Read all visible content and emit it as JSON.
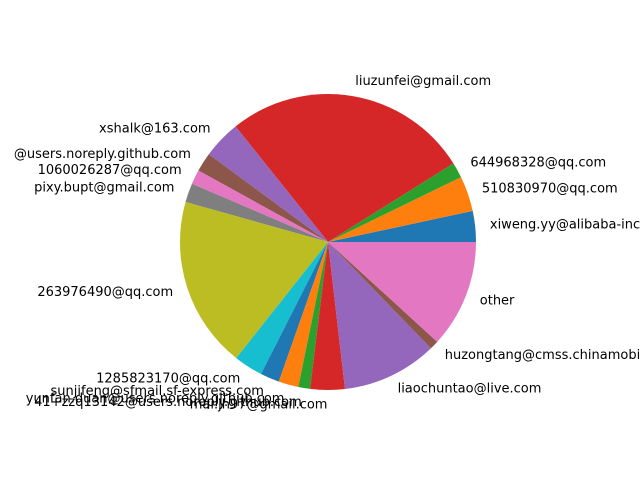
{
  "chart_data": {
    "type": "pie",
    "start_angle": 0,
    "direction": "counterclockwise",
    "slices": [
      {
        "label": "xiweng.yy@alibaba-inc.com",
        "value": 3.4,
        "color": "#1f77b4"
      },
      {
        "label": "510830970@qq.com",
        "value": 3.9,
        "color": "#ff7f0e"
      },
      {
        "label": "644968328@qq.com",
        "value": 1.7,
        "color": "#2ca02c"
      },
      {
        "label": "liuzunfei@gmail.com",
        "value": 27.1,
        "color": "#d62728"
      },
      {
        "label": "xshalk@163.com",
        "value": 4.2,
        "color": "#9467bd"
      },
      {
        "label": "@users.noreply.github.com",
        "value": 2.1,
        "color": "#8c564b"
      },
      {
        "label": "1060026287@qq.com",
        "value": 1.6,
        "color": "#e377c2"
      },
      {
        "label": "pixy.bupt@gmail.com",
        "value": 2.1,
        "color": "#7f7f7f"
      },
      {
        "label": "263976490@qq.com",
        "value": 18.9,
        "color": "#bcbd22"
      },
      {
        "label": "1285823170@qq.com",
        "value": 3.2,
        "color": "#17becf"
      },
      {
        "label": "sunjifeng@sfmail.sf-express.com",
        "value": 2.1,
        "color": "#1f77b4"
      },
      {
        "label": "yunfan.duan@users.noreply.github.com",
        "value": 2.2,
        "color": "#ff7f0e"
      },
      {
        "label": "41+zzq13142@users.noreply.github.com",
        "value": 1.3,
        "color": "#2ca02c"
      },
      {
        "label": "mai.jh97@gmail.com",
        "value": 3.8,
        "color": "#d62728"
      },
      {
        "label": "liaochuntao@live.com",
        "value": 10.5,
        "color": "#9467bd"
      },
      {
        "label": "huzongtang@cmss.chinamobile.com",
        "value": 1.0,
        "color": "#8c564b"
      },
      {
        "label": "other",
        "value": 11.9,
        "color": "#e377c2"
      }
    ]
  }
}
